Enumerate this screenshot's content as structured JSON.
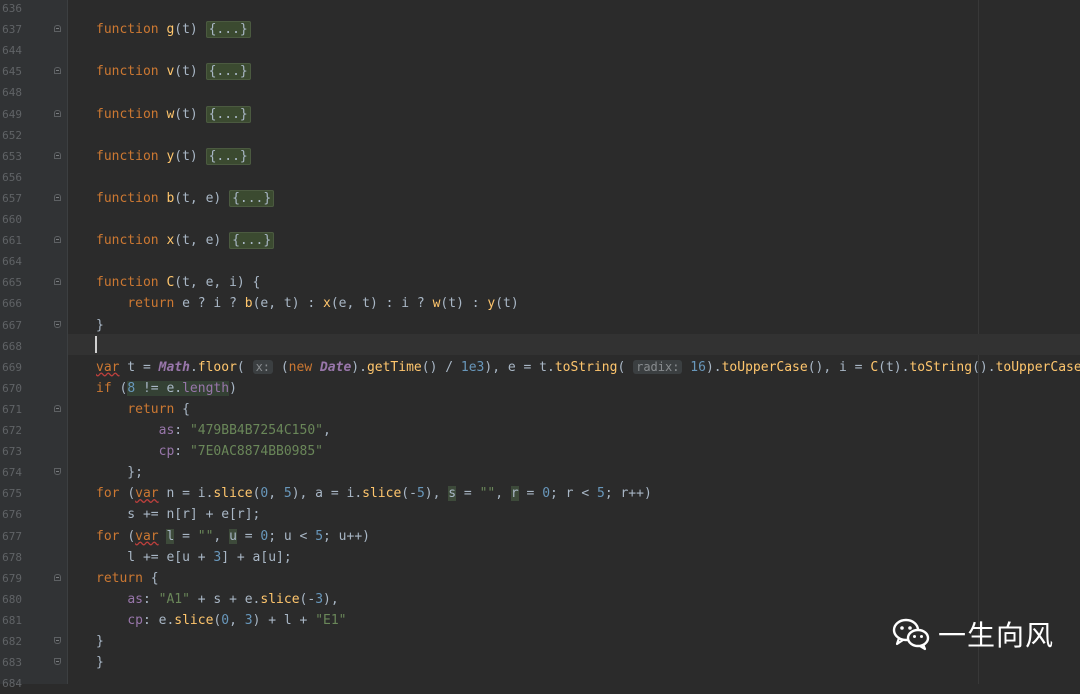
{
  "editor": {
    "caret_line": "668",
    "hints": {
      "x_label": "x:",
      "radix_label": "radix:"
    },
    "lines": [
      {
        "n": "636",
        "top": 0
      },
      {
        "n": "637",
        "tokens": [
          [
            "kw",
            "function "
          ],
          [
            "fn",
            "g"
          ],
          [
            "",
            "(t) "
          ],
          [
            "folded",
            "{...}"
          ]
        ]
      },
      {
        "n": "644"
      },
      {
        "n": "645",
        "tokens": [
          [
            "kw",
            "function "
          ],
          [
            "fn",
            "v"
          ],
          [
            "",
            "(t) "
          ],
          [
            "folded",
            "{...}"
          ]
        ]
      },
      {
        "n": "648"
      },
      {
        "n": "649",
        "tokens": [
          [
            "kw",
            "function "
          ],
          [
            "fn",
            "w"
          ],
          [
            "",
            "(t) "
          ],
          [
            "folded",
            "{...}"
          ]
        ]
      },
      {
        "n": "652"
      },
      {
        "n": "653",
        "tokens": [
          [
            "kw",
            "function "
          ],
          [
            "fn",
            "y"
          ],
          [
            "",
            "(t) "
          ],
          [
            "folded",
            "{...}"
          ]
        ]
      },
      {
        "n": "656"
      },
      {
        "n": "657",
        "tokens": [
          [
            "kw",
            "function "
          ],
          [
            "fn",
            "b"
          ],
          [
            "",
            "(t, e) "
          ],
          [
            "folded",
            "{...}"
          ]
        ]
      },
      {
        "n": "660"
      },
      {
        "n": "661",
        "tokens": [
          [
            "kw",
            "function "
          ],
          [
            "fn",
            "x"
          ],
          [
            "",
            "(t, e) "
          ],
          [
            "folded",
            "{...}"
          ]
        ]
      },
      {
        "n": "664"
      },
      {
        "n": "665",
        "tokens": [
          [
            "kw",
            "function "
          ],
          [
            "fn",
            "C"
          ],
          [
            "",
            "(t, e, i) {"
          ]
        ]
      },
      {
        "n": "666",
        "tokens": [
          [
            "",
            "    "
          ],
          [
            "kw",
            "return "
          ],
          [
            "",
            "e ? i ? "
          ],
          [
            "fn",
            "b"
          ],
          [
            "",
            "(e, t) : "
          ],
          [
            "fn",
            "x"
          ],
          [
            "",
            "(e, t) : i ? "
          ],
          [
            "fn",
            "w"
          ],
          [
            "",
            "(t) : "
          ],
          [
            "fn",
            "y"
          ],
          [
            "",
            "(t)"
          ]
        ]
      },
      {
        "n": "667",
        "tokens": [
          [
            "",
            "}"
          ]
        ]
      },
      {
        "n": "668"
      },
      {
        "n": "669",
        "tokens": [
          [
            "kw squig",
            "var"
          ],
          [
            "",
            " t = "
          ],
          [
            "cls",
            "Math"
          ],
          [
            "",
            "."
          ],
          [
            "fn",
            "floor"
          ],
          [
            "",
            "( "
          ],
          [
            "hint",
            "x:"
          ],
          [
            "",
            " ("
          ],
          [
            "kw",
            "new "
          ],
          [
            "cls",
            "Date"
          ],
          [
            "",
            ")."
          ],
          [
            "fn",
            "getTime"
          ],
          [
            "",
            "() / "
          ],
          [
            "num",
            "1e3"
          ],
          [
            "",
            "), e = t."
          ],
          [
            "fn",
            "toString"
          ],
          [
            "",
            "( "
          ],
          [
            "hint",
            "radix:"
          ],
          [
            "",
            " "
          ],
          [
            "num",
            "16"
          ],
          [
            "",
            ")."
          ],
          [
            "fn",
            "toUpperCase"
          ],
          [
            "",
            "(), i = "
          ],
          [
            "fn",
            "C"
          ],
          [
            "",
            "(t)."
          ],
          [
            "fn",
            "toString"
          ],
          [
            "",
            "()."
          ],
          [
            "fn",
            "toUpperCase"
          ],
          [
            "",
            "();"
          ]
        ]
      },
      {
        "n": "670",
        "tokens": [
          [
            "kw",
            "if "
          ],
          [
            "",
            "("
          ],
          [
            "num hl",
            "8"
          ],
          [
            "hl",
            " != e."
          ],
          [
            "prop hl",
            "length"
          ],
          [
            "",
            ")"
          ]
        ]
      },
      {
        "n": "671",
        "tokens": [
          [
            "",
            "    "
          ],
          [
            "kw",
            "return "
          ],
          [
            "",
            "{"
          ]
        ]
      },
      {
        "n": "672",
        "tokens": [
          [
            "",
            "        "
          ],
          [
            "prop",
            "as"
          ],
          [
            "",
            ": "
          ],
          [
            "str",
            "\"479BB4B7254C150\""
          ],
          [
            "",
            ","
          ]
        ]
      },
      {
        "n": "673",
        "tokens": [
          [
            "",
            "        "
          ],
          [
            "prop",
            "cp"
          ],
          [
            "",
            ": "
          ],
          [
            "str",
            "\"7E0AC8874BB0985\""
          ]
        ]
      },
      {
        "n": "674",
        "tokens": [
          [
            "",
            "    };"
          ]
        ]
      },
      {
        "n": "675",
        "tokens": [
          [
            "kw",
            "for "
          ],
          [
            "",
            "("
          ],
          [
            "kw squig",
            "var"
          ],
          [
            "",
            " n = i."
          ],
          [
            "fn",
            "slice"
          ],
          [
            "",
            "("
          ],
          [
            "num",
            "0"
          ],
          [
            "",
            ", "
          ],
          [
            "num",
            "5"
          ],
          [
            "",
            "), a = i."
          ],
          [
            "fn",
            "slice"
          ],
          [
            "",
            "(-"
          ],
          [
            "num",
            "5"
          ],
          [
            "",
            "), "
          ],
          [
            "hl2",
            "s"
          ],
          [
            "",
            " = "
          ],
          [
            "str",
            "\"\""
          ],
          [
            "",
            ", "
          ],
          [
            "hl2",
            "r"
          ],
          [
            "",
            " = "
          ],
          [
            "num",
            "0"
          ],
          [
            "",
            "; r < "
          ],
          [
            "num",
            "5"
          ],
          [
            "",
            "; r++)"
          ]
        ]
      },
      {
        "n": "676",
        "tokens": [
          [
            "",
            "    s += n[r] + e[r];"
          ]
        ]
      },
      {
        "n": "677",
        "tokens": [
          [
            "kw",
            "for "
          ],
          [
            "",
            "("
          ],
          [
            "kw squig",
            "var"
          ],
          [
            "",
            " "
          ],
          [
            "hl2",
            "l"
          ],
          [
            "",
            " = "
          ],
          [
            "str",
            "\"\""
          ],
          [
            "",
            ", "
          ],
          [
            "hl2",
            "u"
          ],
          [
            "",
            " = "
          ],
          [
            "num",
            "0"
          ],
          [
            "",
            "; u < "
          ],
          [
            "num",
            "5"
          ],
          [
            "",
            "; u++)"
          ]
        ]
      },
      {
        "n": "678",
        "tokens": [
          [
            "",
            "    l += e[u + "
          ],
          [
            "num",
            "3"
          ],
          [
            "",
            "] + a[u];"
          ]
        ]
      },
      {
        "n": "679",
        "tokens": [
          [
            "kw",
            "return "
          ],
          [
            "",
            "{"
          ]
        ]
      },
      {
        "n": "680",
        "tokens": [
          [
            "",
            "    "
          ],
          [
            "prop",
            "as"
          ],
          [
            "",
            ": "
          ],
          [
            "str",
            "\"A1\""
          ],
          [
            "",
            " + s + e."
          ],
          [
            "fn",
            "slice"
          ],
          [
            "",
            "(-"
          ],
          [
            "num",
            "3"
          ],
          [
            "",
            "),"
          ]
        ]
      },
      {
        "n": "681",
        "tokens": [
          [
            "",
            "    "
          ],
          [
            "prop",
            "cp"
          ],
          [
            "",
            ": e."
          ],
          [
            "fn",
            "slice"
          ],
          [
            "",
            "("
          ],
          [
            "num",
            "0"
          ],
          [
            "",
            ", "
          ],
          [
            "num",
            "3"
          ],
          [
            "",
            ") + l + "
          ],
          [
            "str",
            "\"E1\""
          ]
        ]
      },
      {
        "n": "682",
        "tokens": [
          [
            "",
            "}"
          ]
        ]
      },
      {
        "n": "683",
        "tokens": [
          [
            "",
            "}"
          ]
        ]
      },
      {
        "n": "684"
      }
    ]
  },
  "watermark": {
    "text": "一生向风",
    "icon": "wechat-icon"
  }
}
